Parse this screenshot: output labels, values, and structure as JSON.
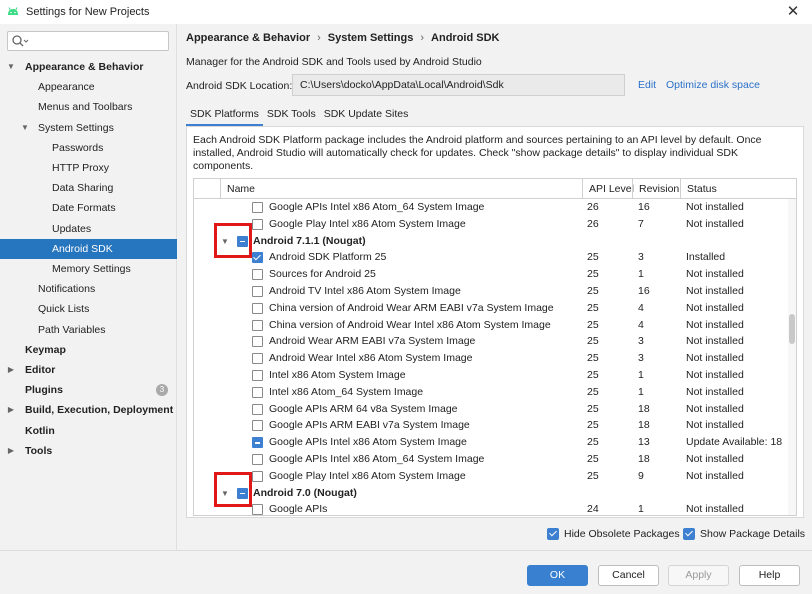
{
  "window": {
    "title": "Settings for New Projects",
    "close_glyph": "✕"
  },
  "search": {
    "placeholder": "",
    "icon": "search-icon"
  },
  "sidebar": {
    "items": [
      {
        "label": "Appearance & Behavior",
        "bold": true,
        "indent": 0,
        "arrow": "▼"
      },
      {
        "label": "Appearance",
        "indent": 1
      },
      {
        "label": "Menus and Toolbars",
        "indent": 1
      },
      {
        "label": "System Settings",
        "indent": 1,
        "arrow": "▼"
      },
      {
        "label": "Passwords",
        "indent": 2
      },
      {
        "label": "HTTP Proxy",
        "indent": 2
      },
      {
        "label": "Data Sharing",
        "indent": 2
      },
      {
        "label": "Date Formats",
        "indent": 2
      },
      {
        "label": "Updates",
        "indent": 2
      },
      {
        "label": "Android SDK",
        "indent": 2,
        "selected": true
      },
      {
        "label": "Memory Settings",
        "indent": 2
      },
      {
        "label": "Notifications",
        "indent": 1
      },
      {
        "label": "Quick Lists",
        "indent": 1
      },
      {
        "label": "Path Variables",
        "indent": 1
      },
      {
        "label": "Keymap",
        "bold": true,
        "indent": 0
      },
      {
        "label": "Editor",
        "bold": true,
        "indent": 0,
        "arrow": "▶"
      },
      {
        "label": "Plugins",
        "bold": true,
        "indent": 0,
        "badge": "3"
      },
      {
        "label": "Build, Execution, Deployment",
        "bold": true,
        "indent": 0,
        "arrow": "▶"
      },
      {
        "label": "Kotlin",
        "bold": true,
        "indent": 0
      },
      {
        "label": "Tools",
        "bold": true,
        "indent": 0,
        "arrow": "▶"
      }
    ]
  },
  "breadcrumb": {
    "parts": [
      "Appearance & Behavior",
      "System Settings",
      "Android SDK"
    ],
    "separator": "›"
  },
  "description": "Manager for the Android SDK and Tools used by Android Studio",
  "sdk_location": {
    "label": "Android SDK Location:",
    "value": "C:\\Users\\docko\\AppData\\Local\\Android\\Sdk",
    "edit": "Edit",
    "optimize": "Optimize disk space"
  },
  "tabs": [
    {
      "label": "SDK Platforms",
      "active": true
    },
    {
      "label": "SDK Tools"
    },
    {
      "label": "SDK Update Sites"
    }
  ],
  "panel_description": "Each Android SDK Platform package includes the Android platform and sources pertaining to an API level by default. Once installed, Android Studio will automatically check for updates. Check \"show package details\" to display individual SDK components.",
  "table": {
    "headers": [
      "Name",
      "API Level",
      "Revision",
      "Status"
    ],
    "rows": [
      {
        "name": "Google APIs Intel x86 Atom_64 System Image",
        "api": "26",
        "rev": "16",
        "status": "Not installed",
        "check": "unchecked"
      },
      {
        "name": "Google Play Intel x86 Atom System Image",
        "api": "26",
        "rev": "7",
        "status": "Not installed",
        "check": "unchecked"
      },
      {
        "name": "Android 7.1.1 (Nougat)",
        "group": true,
        "check": "partial"
      },
      {
        "name": "Android SDK Platform 25",
        "api": "25",
        "rev": "3",
        "status": "Installed",
        "check": "checked"
      },
      {
        "name": "Sources for Android 25",
        "api": "25",
        "rev": "1",
        "status": "Not installed",
        "check": "unchecked"
      },
      {
        "name": "Android TV Intel x86 Atom System Image",
        "api": "25",
        "rev": "16",
        "status": "Not installed",
        "check": "unchecked"
      },
      {
        "name": "China version of Android Wear ARM EABI v7a System Image",
        "api": "25",
        "rev": "4",
        "status": "Not installed",
        "check": "unchecked"
      },
      {
        "name": "China version of Android Wear Intel x86 Atom System Image",
        "api": "25",
        "rev": "4",
        "status": "Not installed",
        "check": "unchecked"
      },
      {
        "name": "Android Wear ARM EABI v7a System Image",
        "api": "25",
        "rev": "3",
        "status": "Not installed",
        "check": "unchecked"
      },
      {
        "name": "Android Wear Intel x86 Atom System Image",
        "api": "25",
        "rev": "3",
        "status": "Not installed",
        "check": "unchecked"
      },
      {
        "name": "Intel x86 Atom System Image",
        "api": "25",
        "rev": "1",
        "status": "Not installed",
        "check": "unchecked"
      },
      {
        "name": "Intel x86 Atom_64 System Image",
        "api": "25",
        "rev": "1",
        "status": "Not installed",
        "check": "unchecked"
      },
      {
        "name": "Google APIs ARM 64 v8a System Image",
        "api": "25",
        "rev": "18",
        "status": "Not installed",
        "check": "unchecked"
      },
      {
        "name": "Google APIs ARM EABI v7a System Image",
        "api": "25",
        "rev": "18",
        "status": "Not installed",
        "check": "unchecked"
      },
      {
        "name": "Google APIs Intel x86 Atom System Image",
        "api": "25",
        "rev": "13",
        "status": "Update Available: 18",
        "check": "partial"
      },
      {
        "name": "Google APIs Intel x86 Atom_64 System Image",
        "api": "25",
        "rev": "18",
        "status": "Not installed",
        "check": "unchecked"
      },
      {
        "name": "Google Play Intel x86 Atom System Image",
        "api": "25",
        "rev": "9",
        "status": "Not installed",
        "check": "unchecked"
      },
      {
        "name": "Android 7.0 (Nougat)",
        "group": true,
        "check": "partial"
      },
      {
        "name": "Google APIs",
        "api": "24",
        "rev": "1",
        "status": "Not installed",
        "check": "unchecked"
      }
    ]
  },
  "options": {
    "hide_obsolete": {
      "label": "Hide Obsolete Packages",
      "checked": true
    },
    "show_details": {
      "label": "Show Package Details",
      "checked": true
    }
  },
  "buttons": {
    "ok": "OK",
    "cancel": "Cancel",
    "apply": "Apply",
    "help": "Help"
  },
  "colors": {
    "accent": "#3d7fd1",
    "selection": "#2675bf",
    "highlight_box": "#e01818",
    "link": "#2a70c8"
  }
}
